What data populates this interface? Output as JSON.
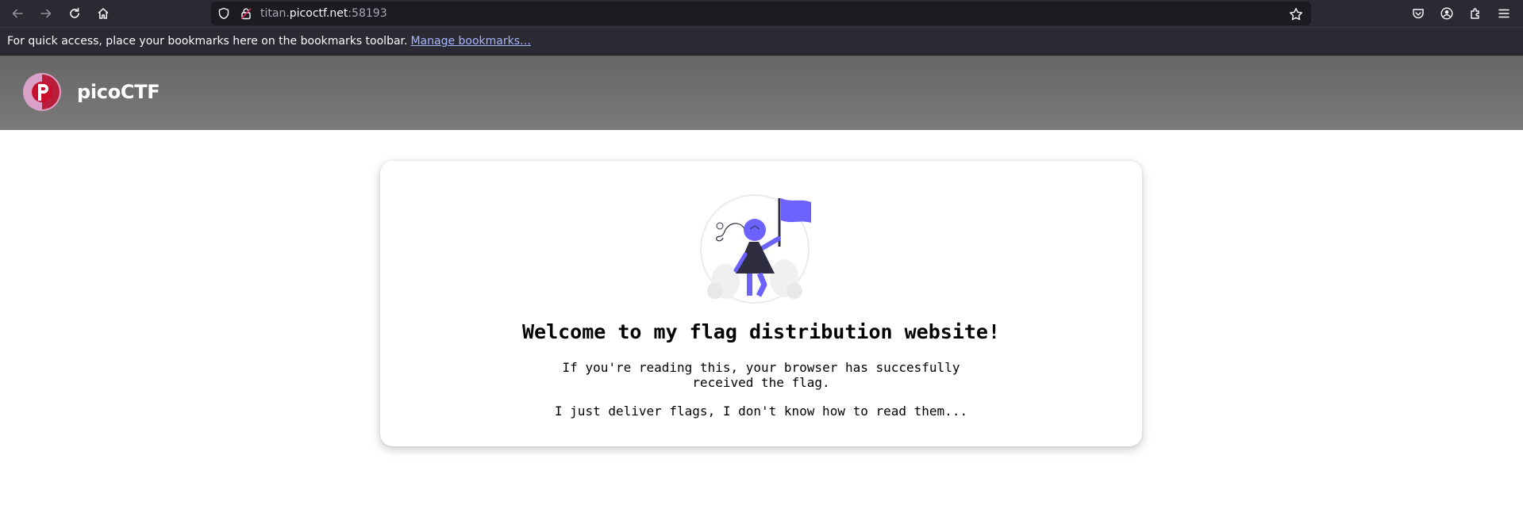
{
  "browser": {
    "url_host_prefix": "titan.",
    "url_host_domain": "picoctf.net",
    "url_port": ":58193",
    "bookmarks_message": "For quick access, place your bookmarks here on the bookmarks toolbar.",
    "manage_bookmarks_link": "Manage bookmarks…",
    "icons": [
      "back-icon",
      "forward-icon",
      "reload-icon",
      "home-icon",
      "shield-icon",
      "lock-icon",
      "star-icon",
      "pocket-icon",
      "account-icon",
      "extensions-icon",
      "menu-icon"
    ]
  },
  "site": {
    "brand_name": "picoCTF",
    "colors": {
      "logo_red": "#c8102e",
      "logo_ring": "#d9a0c8",
      "accent_purple": "#6c63ff"
    }
  },
  "card": {
    "heading": "Welcome to my flag distribution website!",
    "paragraph1": "If you're reading this, your browser has succesfully received the flag.",
    "paragraph2": "I just deliver flags, I don't know how to read them..."
  }
}
